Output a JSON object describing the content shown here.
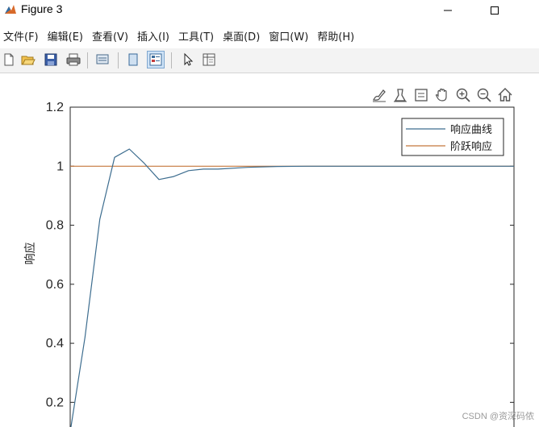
{
  "window": {
    "title": "Figure 3",
    "icon": "matlab-icon",
    "controls": [
      "minimize-icon",
      "maximize-icon"
    ]
  },
  "menu": [
    {
      "label": "文件(F)"
    },
    {
      "label": "编辑(E)"
    },
    {
      "label": "查看(V)"
    },
    {
      "label": "插入(I)"
    },
    {
      "label": "工具(T)"
    },
    {
      "label": "桌面(D)"
    },
    {
      "label": "窗口(W)"
    },
    {
      "label": "帮助(H)"
    }
  ],
  "toolbar": {
    "buttons": [
      "new-figure-icon",
      "open-file-icon",
      "save-icon",
      "print-icon",
      "link-plot-icon",
      "hide-plot-tools-icon",
      "show-plot-tools-icon",
      "edit-plot-arrow-icon",
      "open-property-inspector-icon"
    ],
    "active": "show-plot-tools-icon"
  },
  "axes_toolbar": [
    "brush-icon",
    "data-tips-icon",
    "restore-view-icon",
    "pan-hand-icon",
    "zoom-in-icon",
    "zoom-out-icon",
    "home-icon"
  ],
  "colors": {
    "response_line": "#3d6d8f",
    "step_line": "#c4773c",
    "axes": "#262626",
    "toolbar_bg": "#f3f3f3"
  },
  "chart_data": {
    "type": "line",
    "ylabel": "响应",
    "xlabel": "",
    "title": "",
    "yticks": [
      "0.2",
      "0.4",
      "0.6",
      "0.8",
      "1",
      "1.2"
    ],
    "ylim": [
      0.1,
      1.2
    ],
    "xlim": [
      0,
      30
    ],
    "legend": {
      "position": "top-right",
      "entries": [
        "响应曲线",
        "阶跃响应"
      ]
    },
    "series": [
      {
        "name": "响应曲线",
        "color": "#3d6d8f",
        "x": [
          0,
          1,
          2,
          3,
          4,
          5,
          6,
          7,
          8,
          9,
          10,
          12,
          14,
          16,
          18,
          20,
          25,
          30
        ],
        "y": [
          0.1,
          0.42,
          0.82,
          1.03,
          1.058,
          1.01,
          0.955,
          0.965,
          0.985,
          0.99,
          0.99,
          0.996,
          0.999,
          1.0,
          1.0,
          1.0,
          1.0,
          1.0
        ]
      },
      {
        "name": "阶跃响应",
        "color": "#c4773c",
        "x": [
          0,
          30
        ],
        "y": [
          1.0,
          1.0
        ]
      }
    ]
  },
  "watermark": "CSDN @资深码侬"
}
